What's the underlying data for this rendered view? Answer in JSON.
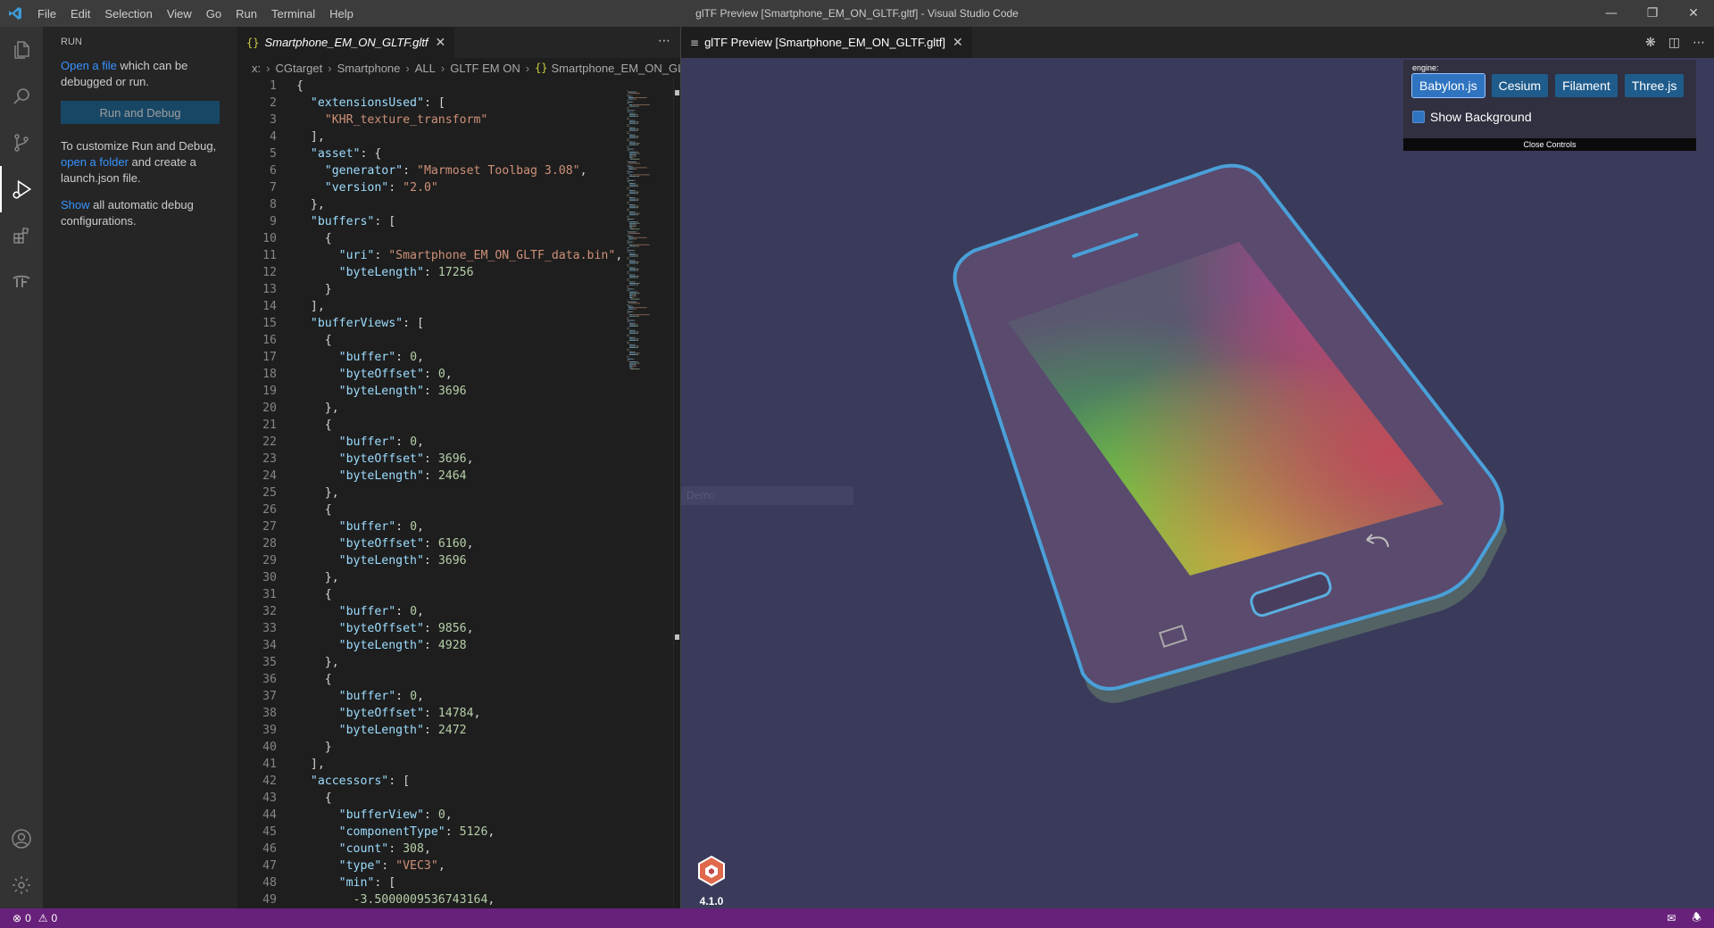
{
  "window": {
    "title": "glTF Preview [Smartphone_EM_ON_GLTF.gltf] - Visual Studio Code",
    "menu": [
      "File",
      "Edit",
      "Selection",
      "View",
      "Go",
      "Run",
      "Terminal",
      "Help"
    ]
  },
  "activity_bar": {
    "items": [
      "files-icon",
      "search-icon",
      "source-control-icon",
      "run-debug-icon",
      "extensions-icon",
      "tf-icon"
    ],
    "bottom": [
      "account-icon",
      "settings-icon"
    ]
  },
  "sidebar": {
    "title": "RUN",
    "open_file_link": "Open a file",
    "open_file_rest": " which can be debugged or run.",
    "run_button": "Run and Debug",
    "customize_text": "To customize Run and Debug, ",
    "open_folder_link": "open a folder",
    "customize_rest": " and create a launch.json file.",
    "show_link": "Show",
    "show_rest": " all automatic debug configurations."
  },
  "editor": {
    "tab_label": "Smartphone_EM_ON_GLTF.gltf",
    "tab_icon": "{}",
    "breadcrumb": [
      "x:",
      "CGtarget",
      "Smartphone",
      "ALL",
      "GLTF EM ON",
      "Smartphone_EM_ON_GLTF"
    ],
    "lines": [
      [
        [
          "p",
          "{"
        ]
      ],
      [
        [
          "p",
          "  "
        ],
        [
          "k",
          "\"extensionsUsed\""
        ],
        [
          "p",
          ": ["
        ]
      ],
      [
        [
          "p",
          "    "
        ],
        [
          "s",
          "\"KHR_texture_transform\""
        ]
      ],
      [
        [
          "p",
          "  ],"
        ]
      ],
      [
        [
          "p",
          "  "
        ],
        [
          "k",
          "\"asset\""
        ],
        [
          "p",
          ": {"
        ]
      ],
      [
        [
          "p",
          "    "
        ],
        [
          "k",
          "\"generator\""
        ],
        [
          "p",
          ": "
        ],
        [
          "s",
          "\"Marmoset Toolbag 3.08\""
        ],
        [
          "p",
          ","
        ]
      ],
      [
        [
          "p",
          "    "
        ],
        [
          "k",
          "\"version\""
        ],
        [
          "p",
          ": "
        ],
        [
          "s",
          "\"2.0\""
        ]
      ],
      [
        [
          "p",
          "  },"
        ]
      ],
      [
        [
          "p",
          "  "
        ],
        [
          "k",
          "\"buffers\""
        ],
        [
          "p",
          ": ["
        ]
      ],
      [
        [
          "p",
          "    {"
        ]
      ],
      [
        [
          "p",
          "      "
        ],
        [
          "k",
          "\"uri\""
        ],
        [
          "p",
          ": "
        ],
        [
          "s",
          "\"Smartphone_EM_ON_GLTF_data.bin\""
        ],
        [
          "p",
          ","
        ]
      ],
      [
        [
          "p",
          "      "
        ],
        [
          "k",
          "\"byteLength\""
        ],
        [
          "p",
          ": "
        ],
        [
          "n",
          "17256"
        ]
      ],
      [
        [
          "p",
          "    }"
        ]
      ],
      [
        [
          "p",
          "  ],"
        ]
      ],
      [
        [
          "p",
          "  "
        ],
        [
          "k",
          "\"bufferViews\""
        ],
        [
          "p",
          ": ["
        ]
      ],
      [
        [
          "p",
          "    {"
        ]
      ],
      [
        [
          "p",
          "      "
        ],
        [
          "k",
          "\"buffer\""
        ],
        [
          "p",
          ": "
        ],
        [
          "n",
          "0"
        ],
        [
          "p",
          ","
        ]
      ],
      [
        [
          "p",
          "      "
        ],
        [
          "k",
          "\"byteOffset\""
        ],
        [
          "p",
          ": "
        ],
        [
          "n",
          "0"
        ],
        [
          "p",
          ","
        ]
      ],
      [
        [
          "p",
          "      "
        ],
        [
          "k",
          "\"byteLength\""
        ],
        [
          "p",
          ": "
        ],
        [
          "n",
          "3696"
        ]
      ],
      [
        [
          "p",
          "    },"
        ]
      ],
      [
        [
          "p",
          "    {"
        ]
      ],
      [
        [
          "p",
          "      "
        ],
        [
          "k",
          "\"buffer\""
        ],
        [
          "p",
          ": "
        ],
        [
          "n",
          "0"
        ],
        [
          "p",
          ","
        ]
      ],
      [
        [
          "p",
          "      "
        ],
        [
          "k",
          "\"byteOffset\""
        ],
        [
          "p",
          ": "
        ],
        [
          "n",
          "3696"
        ],
        [
          "p",
          ","
        ]
      ],
      [
        [
          "p",
          "      "
        ],
        [
          "k",
          "\"byteLength\""
        ],
        [
          "p",
          ": "
        ],
        [
          "n",
          "2464"
        ]
      ],
      [
        [
          "p",
          "    },"
        ]
      ],
      [
        [
          "p",
          "    {"
        ]
      ],
      [
        [
          "p",
          "      "
        ],
        [
          "k",
          "\"buffer\""
        ],
        [
          "p",
          ": "
        ],
        [
          "n",
          "0"
        ],
        [
          "p",
          ","
        ]
      ],
      [
        [
          "p",
          "      "
        ],
        [
          "k",
          "\"byteOffset\""
        ],
        [
          "p",
          ": "
        ],
        [
          "n",
          "6160"
        ],
        [
          "p",
          ","
        ]
      ],
      [
        [
          "p",
          "      "
        ],
        [
          "k",
          "\"byteLength\""
        ],
        [
          "p",
          ": "
        ],
        [
          "n",
          "3696"
        ]
      ],
      [
        [
          "p",
          "    },"
        ]
      ],
      [
        [
          "p",
          "    {"
        ]
      ],
      [
        [
          "p",
          "      "
        ],
        [
          "k",
          "\"buffer\""
        ],
        [
          "p",
          ": "
        ],
        [
          "n",
          "0"
        ],
        [
          "p",
          ","
        ]
      ],
      [
        [
          "p",
          "      "
        ],
        [
          "k",
          "\"byteOffset\""
        ],
        [
          "p",
          ": "
        ],
        [
          "n",
          "9856"
        ],
        [
          "p",
          ","
        ]
      ],
      [
        [
          "p",
          "      "
        ],
        [
          "k",
          "\"byteLength\""
        ],
        [
          "p",
          ": "
        ],
        [
          "n",
          "4928"
        ]
      ],
      [
        [
          "p",
          "    },"
        ]
      ],
      [
        [
          "p",
          "    {"
        ]
      ],
      [
        [
          "p",
          "      "
        ],
        [
          "k",
          "\"buffer\""
        ],
        [
          "p",
          ": "
        ],
        [
          "n",
          "0"
        ],
        [
          "p",
          ","
        ]
      ],
      [
        [
          "p",
          "      "
        ],
        [
          "k",
          "\"byteOffset\""
        ],
        [
          "p",
          ": "
        ],
        [
          "n",
          "14784"
        ],
        [
          "p",
          ","
        ]
      ],
      [
        [
          "p",
          "      "
        ],
        [
          "k",
          "\"byteLength\""
        ],
        [
          "p",
          ": "
        ],
        [
          "n",
          "2472"
        ]
      ],
      [
        [
          "p",
          "    }"
        ]
      ],
      [
        [
          "p",
          "  ],"
        ]
      ],
      [
        [
          "p",
          "  "
        ],
        [
          "k",
          "\"accessors\""
        ],
        [
          "p",
          ": ["
        ]
      ],
      [
        [
          "p",
          "    {"
        ]
      ],
      [
        [
          "p",
          "      "
        ],
        [
          "k",
          "\"bufferView\""
        ],
        [
          "p",
          ": "
        ],
        [
          "n",
          "0"
        ],
        [
          "p",
          ","
        ]
      ],
      [
        [
          "p",
          "      "
        ],
        [
          "k",
          "\"componentType\""
        ],
        [
          "p",
          ": "
        ],
        [
          "n",
          "5126"
        ],
        [
          "p",
          ","
        ]
      ],
      [
        [
          "p",
          "      "
        ],
        [
          "k",
          "\"count\""
        ],
        [
          "p",
          ": "
        ],
        [
          "n",
          "308"
        ],
        [
          "p",
          ","
        ]
      ],
      [
        [
          "p",
          "      "
        ],
        [
          "k",
          "\"type\""
        ],
        [
          "p",
          ": "
        ],
        [
          "s",
          "\"VEC3\""
        ],
        [
          "p",
          ","
        ]
      ],
      [
        [
          "p",
          "      "
        ],
        [
          "k",
          "\"min\""
        ],
        [
          "p",
          ": ["
        ]
      ],
      [
        [
          "p",
          "        "
        ],
        [
          "n",
          "-3.5000009536743164"
        ],
        [
          "p",
          ","
        ]
      ]
    ]
  },
  "preview": {
    "tab_label": "glTF Preview [Smartphone_EM_ON_GLTF.gltf]",
    "engine_label": "engine:",
    "engines": [
      "Babylon.js",
      "Cesium",
      "Filament",
      "Three.js"
    ],
    "active_engine": "Babylon.js",
    "show_background_label": "Show Background",
    "close_controls_label": "Close Controls",
    "ghost_label": "Demo",
    "version": "4.1.0",
    "background_color": "#3a3a5a"
  },
  "status_bar": {
    "errors": "0",
    "warnings": "0",
    "color": "#68217a"
  }
}
